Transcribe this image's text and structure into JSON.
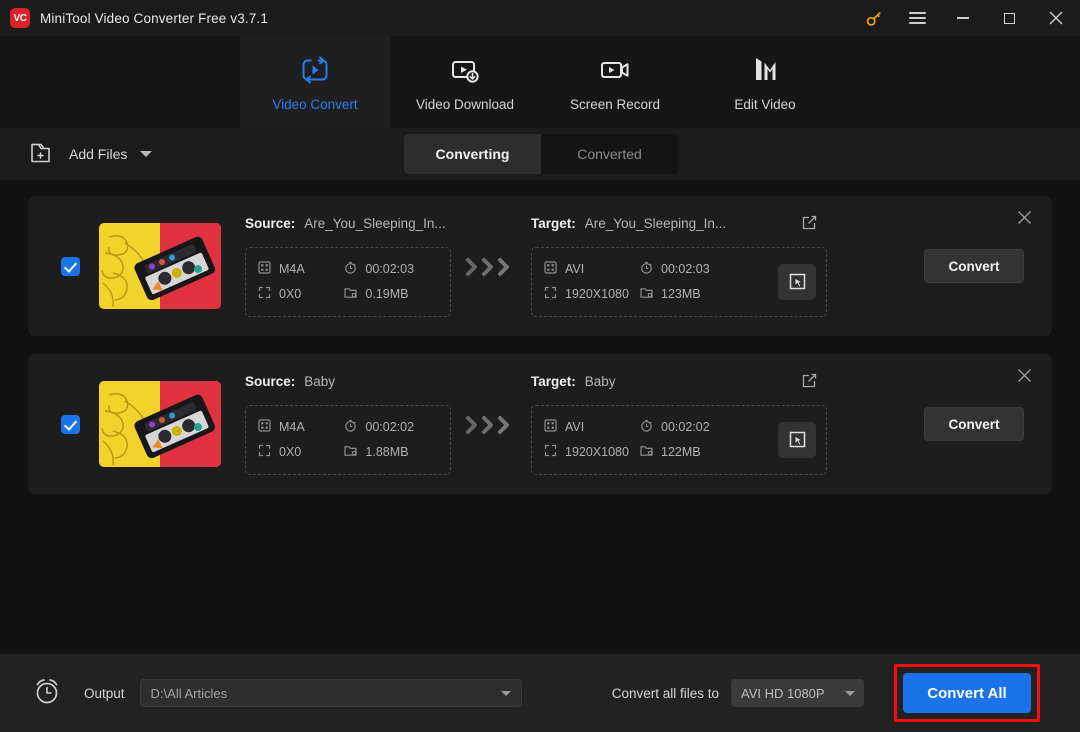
{
  "window": {
    "title": "MiniTool Video Converter Free v3.7.1",
    "logo_text": "VC",
    "controls": {
      "key": "key-icon",
      "menu": "hamburger-menu-icon",
      "minimize": "minimize-icon",
      "maximize": "maximize-icon",
      "close": "close-icon"
    },
    "accent_blue": "#1a73e8",
    "highlight_red": "#fc0d0d",
    "key_orange": "#f0a318"
  },
  "nav": {
    "tabs": [
      {
        "label": "Video Convert",
        "icon": "video-convert-icon",
        "active": true
      },
      {
        "label": "Video Download",
        "icon": "video-download-icon",
        "active": false
      },
      {
        "label": "Screen Record",
        "icon": "screen-record-icon",
        "active": false
      },
      {
        "label": "Edit Video",
        "icon": "edit-video-icon",
        "active": false
      }
    ]
  },
  "toolbar": {
    "add_files_label": "Add Files",
    "add_files_icon": "add-folder-icon",
    "dropdown_icon": "chevron-down-icon",
    "segments": [
      {
        "label": "Converting",
        "active": true
      },
      {
        "label": "Converted",
        "active": false
      }
    ]
  },
  "files": [
    {
      "checked": true,
      "thumbnail": "cassette-tape-thumbnail",
      "source": {
        "label": "Source:",
        "name": "Are_You_Sleeping_In...",
        "format": "M4A",
        "duration": "00:02:03",
        "resolution": "0X0",
        "size": "0.19MB"
      },
      "target": {
        "label": "Target:",
        "name": "Are_You_Sleeping_In...",
        "format": "AVI",
        "duration": "00:02:03",
        "resolution": "1920X1080",
        "size": "123MB"
      },
      "convert_label": "Convert"
    },
    {
      "checked": true,
      "thumbnail": "cassette-tape-thumbnail",
      "source": {
        "label": "Source:",
        "name": "Baby",
        "format": "M4A",
        "duration": "00:02:02",
        "resolution": "0X0",
        "size": "1.88MB"
      },
      "target": {
        "label": "Target:",
        "name": "Baby",
        "format": "AVI",
        "duration": "00:02:02",
        "resolution": "1920X1080",
        "size": "122MB"
      },
      "convert_label": "Convert"
    }
  ],
  "bottom": {
    "clock_icon": "alarm-clock-icon",
    "output_label": "Output",
    "output_path": "D:\\All Articles",
    "convert_all_files_to_label": "Convert all files to",
    "format_value": "AVI HD 1080P",
    "convert_all_label": "Convert All"
  },
  "icons": {
    "format": "format-icon",
    "duration": "stopwatch-icon",
    "resolution": "resize-icon",
    "size": "folder-size-icon",
    "chevrons": "triple-chevron-right-icon",
    "edit": "edit-square-icon",
    "crop": "crop-cursor-icon",
    "remove": "close-icon"
  }
}
